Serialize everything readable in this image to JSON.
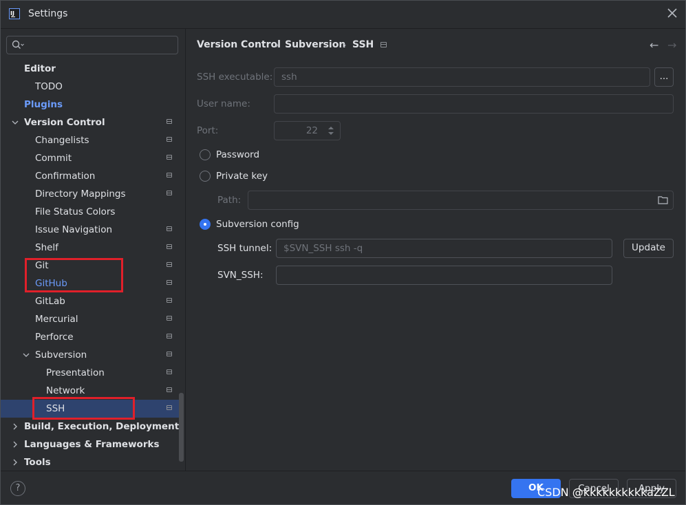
{
  "window": {
    "title": "Settings",
    "app_icon_text": "IJ"
  },
  "search": {
    "value": ""
  },
  "tree": [
    {
      "label": "Editor",
      "level": 0,
      "bold": true
    },
    {
      "label": "TODO",
      "level": 1
    },
    {
      "label": "Plugins",
      "level": 0,
      "bold": true,
      "link": true
    },
    {
      "label": "Version Control",
      "level": 0,
      "bold": true,
      "expanded": true,
      "page_icon": true
    },
    {
      "label": "Changelists",
      "level": 1,
      "page_icon": true
    },
    {
      "label": "Commit",
      "level": 1,
      "page_icon": true
    },
    {
      "label": "Confirmation",
      "level": 1,
      "page_icon": true
    },
    {
      "label": "Directory Mappings",
      "level": 1,
      "page_icon": true
    },
    {
      "label": "File Status Colors",
      "level": 1
    },
    {
      "label": "Issue Navigation",
      "level": 1,
      "page_icon": true
    },
    {
      "label": "Shelf",
      "level": 1,
      "page_icon": true
    },
    {
      "label": "Git",
      "level": 1,
      "page_icon": true
    },
    {
      "label": "GitHub",
      "level": 1,
      "link": true,
      "page_icon": true
    },
    {
      "label": "GitLab",
      "level": 1,
      "page_icon": true
    },
    {
      "label": "Mercurial",
      "level": 1,
      "page_icon": true
    },
    {
      "label": "Perforce",
      "level": 1,
      "page_icon": true
    },
    {
      "label": "Subversion",
      "level": 1,
      "expanded": true,
      "page_icon": true
    },
    {
      "label": "Presentation",
      "level": 2,
      "page_icon": true
    },
    {
      "label": "Network",
      "level": 2,
      "page_icon": true
    },
    {
      "label": "SSH",
      "level": 2,
      "selected": true,
      "page_icon": true
    },
    {
      "label": "Build, Execution, Deployment",
      "level": 0,
      "bold": true,
      "collapsed": true
    },
    {
      "label": "Languages & Frameworks",
      "level": 0,
      "bold": true,
      "collapsed": true
    },
    {
      "label": "Tools",
      "level": 0,
      "bold": true,
      "collapsed": true
    }
  ],
  "breadcrumb": [
    "Version Control",
    "Subversion",
    "SSH"
  ],
  "breadcrumb_sep": "›",
  "nav": {
    "back": "←",
    "forward": "→"
  },
  "form": {
    "ssh_executable": {
      "label": "SSH executable:",
      "value": "ssh",
      "browse": "..."
    },
    "user_name": {
      "label": "User name:",
      "value": ""
    },
    "port": {
      "label": "Port:",
      "value": "22"
    },
    "radio_password": "Password",
    "radio_private_key": "Private key",
    "path": {
      "label": "Path:",
      "value": ""
    },
    "radio_subversion_config": "Subversion config",
    "ssh_tunnel": {
      "label": "SSH tunnel:",
      "placeholder": "$SVN_SSH ssh -q",
      "update": "Update"
    },
    "svn_ssh": {
      "label": "SVN_SSH:",
      "value": ""
    }
  },
  "footer": {
    "help": "?",
    "ok": "OK",
    "cancel": "Cancel",
    "apply": "Apply"
  },
  "watermark": "CSDN @kkkkkkkkkkaZZL",
  "colors": {
    "accent": "#3574f0",
    "link": "#6b9bfa",
    "selection": "#2e436e",
    "highlight_box": "#e0202a",
    "background": "#2b2d30"
  }
}
